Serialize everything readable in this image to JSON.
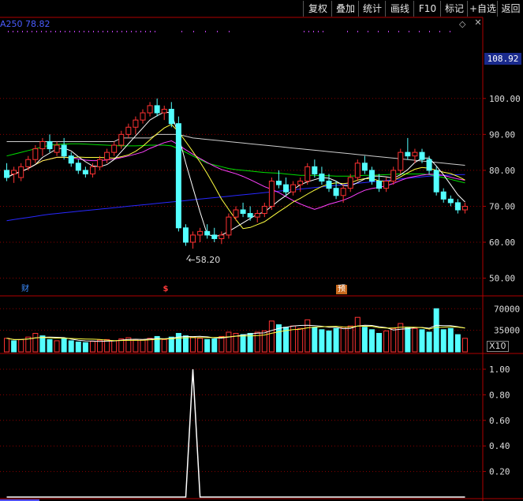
{
  "toolbar": {
    "buttons": [
      "复权",
      "叠加",
      "统计",
      "画线",
      "F10",
      "标记",
      "+自选",
      "返回"
    ]
  },
  "indicator": {
    "ma250_label": "A250",
    "ma250_value": "78.82"
  },
  "price_axis": {
    "ticks": [
      "100.00",
      "90.00",
      "80.00",
      "70.00",
      "60.00",
      "50.00"
    ],
    "current": "108.92"
  },
  "min_marker": {
    "label": "58.20"
  },
  "events": {
    "cai": "财",
    "s": "$",
    "yu": "预"
  },
  "volume_axis": {
    "ticks": [
      "70000",
      "35000"
    ],
    "multiplier": "X10"
  },
  "osc_axis": {
    "ticks": [
      "1.00",
      "0.80",
      "0.60",
      "0.40",
      "0.20"
    ]
  },
  "colors": {
    "up": "#ff3232",
    "down": "#54ffff",
    "ma5": "#ffffff",
    "ma10": "#ffff40",
    "ma20": "#ff40ff",
    "ma60": "#00e000",
    "ma120": "#cccccc",
    "ma250": "#2828ff",
    "grid": "#8b0000"
  },
  "chart_data": {
    "type": "candlestick",
    "ylim": [
      45,
      110
    ],
    "candles": [
      [
        80,
        82,
        77,
        78
      ],
      [
        79,
        81,
        76.5,
        80
      ],
      [
        78,
        82,
        77,
        81
      ],
      [
        81,
        84,
        80,
        83
      ],
      [
        83,
        87,
        82,
        86
      ],
      [
        86,
        89,
        84,
        88
      ],
      [
        88,
        90,
        85,
        86
      ],
      [
        85,
        88,
        84,
        87
      ],
      [
        87,
        89,
        83,
        84
      ],
      [
        84,
        85,
        81,
        82
      ],
      [
        82,
        83,
        79,
        80
      ],
      [
        80,
        81,
        78,
        79
      ],
      [
        79,
        82,
        78,
        81
      ],
      [
        81,
        84,
        80,
        83
      ],
      [
        83,
        86,
        82,
        85
      ],
      [
        85,
        88,
        84,
        87
      ],
      [
        87,
        91,
        86,
        90
      ],
      [
        90,
        93,
        89,
        92
      ],
      [
        92,
        95,
        90,
        94
      ],
      [
        94,
        97,
        93,
        96
      ],
      [
        96,
        99,
        95,
        98
      ],
      [
        98,
        100,
        95,
        96
      ],
      [
        96,
        98,
        94,
        97
      ],
      [
        97,
        99,
        92,
        93
      ],
      [
        93,
        95,
        63,
        64
      ],
      [
        64,
        65,
        59,
        60
      ],
      [
        60,
        63,
        58.2,
        62
      ],
      [
        62,
        64,
        60,
        63
      ],
      [
        63,
        65,
        61,
        62
      ],
      [
        62,
        64,
        60,
        61
      ],
      [
        61,
        63,
        59.5,
        62
      ],
      [
        62,
        68,
        61,
        67
      ],
      [
        67,
        70,
        66,
        69
      ],
      [
        69,
        71,
        67,
        68
      ],
      [
        68,
        70,
        66,
        67
      ],
      [
        67,
        69,
        65.5,
        68
      ],
      [
        68,
        71,
        67,
        70
      ],
      [
        70,
        78,
        69,
        77
      ],
      [
        77,
        80,
        75,
        76
      ],
      [
        76,
        78,
        73,
        74
      ],
      [
        74,
        77,
        73,
        76
      ],
      [
        76,
        78,
        74,
        77
      ],
      [
        77,
        82,
        76,
        81
      ],
      [
        81,
        83,
        78,
        79
      ],
      [
        79,
        81,
        76,
        77
      ],
      [
        77,
        79,
        74,
        75
      ],
      [
        75,
        77,
        72,
        73
      ],
      [
        73,
        76,
        71,
        75
      ],
      [
        75,
        79,
        74,
        78
      ],
      [
        78,
        83,
        77,
        82
      ],
      [
        82,
        84,
        79,
        80
      ],
      [
        80,
        81,
        76,
        77
      ],
      [
        77,
        79,
        74,
        75
      ],
      [
        75,
        78,
        74,
        77
      ],
      [
        77,
        81,
        76,
        80
      ],
      [
        80,
        86,
        79,
        85
      ],
      [
        85,
        89,
        83,
        84
      ],
      [
        84,
        86,
        82,
        85
      ],
      [
        85,
        86,
        82,
        83
      ],
      [
        83,
        84,
        79,
        80
      ],
      [
        80,
        81,
        73,
        74
      ],
      [
        74,
        75,
        71,
        72
      ],
      [
        72,
        73,
        70,
        71
      ],
      [
        71,
        72,
        68,
        69
      ],
      [
        69,
        71,
        68,
        70
      ]
    ],
    "volume": [
      [
        22000,
        "up"
      ],
      [
        18000,
        "down"
      ],
      [
        20000,
        "up"
      ],
      [
        24000,
        "up"
      ],
      [
        30000,
        "up"
      ],
      [
        26000,
        "down"
      ],
      [
        20000,
        "down"
      ],
      [
        18000,
        "up"
      ],
      [
        22000,
        "down"
      ],
      [
        18000,
        "down"
      ],
      [
        16000,
        "down"
      ],
      [
        15000,
        "down"
      ],
      [
        17000,
        "up"
      ],
      [
        19000,
        "up"
      ],
      [
        20000,
        "up"
      ],
      [
        18000,
        "up"
      ],
      [
        21000,
        "up"
      ],
      [
        23000,
        "up"
      ],
      [
        20000,
        "up"
      ],
      [
        19000,
        "up"
      ],
      [
        22000,
        "up"
      ],
      [
        25000,
        "down"
      ],
      [
        20000,
        "up"
      ],
      [
        24000,
        "down"
      ],
      [
        30000,
        "down"
      ],
      [
        26000,
        "down"
      ],
      [
        24000,
        "up"
      ],
      [
        22000,
        "up"
      ],
      [
        20000,
        "down"
      ],
      [
        21000,
        "down"
      ],
      [
        25000,
        "up"
      ],
      [
        32000,
        "up"
      ],
      [
        30000,
        "up"
      ],
      [
        28000,
        "down"
      ],
      [
        30000,
        "down"
      ],
      [
        32000,
        "up"
      ],
      [
        34000,
        "up"
      ],
      [
        50000,
        "up"
      ],
      [
        44000,
        "down"
      ],
      [
        40000,
        "down"
      ],
      [
        42000,
        "up"
      ],
      [
        38000,
        "up"
      ],
      [
        52000,
        "up"
      ],
      [
        40000,
        "down"
      ],
      [
        36000,
        "down"
      ],
      [
        34000,
        "down"
      ],
      [
        38000,
        "down"
      ],
      [
        40000,
        "up"
      ],
      [
        42000,
        "up"
      ],
      [
        56000,
        "up"
      ],
      [
        40000,
        "down"
      ],
      [
        36000,
        "down"
      ],
      [
        30000,
        "down"
      ],
      [
        34000,
        "up"
      ],
      [
        38000,
        "up"
      ],
      [
        46000,
        "up"
      ],
      [
        40000,
        "down"
      ],
      [
        38000,
        "up"
      ],
      [
        36000,
        "down"
      ],
      [
        32000,
        "down"
      ],
      [
        70000,
        "down"
      ],
      [
        36000,
        "down"
      ],
      [
        38000,
        "down"
      ],
      [
        28000,
        "down"
      ],
      [
        22000,
        "up"
      ]
    ],
    "osc": {
      "peak_index": 26,
      "peak_value": 1.0
    },
    "ma120": [
      88,
      88,
      88,
      88,
      88,
      88,
      88,
      88,
      88,
      88,
      88,
      88,
      88,
      88,
      88,
      88,
      89,
      89,
      89,
      89,
      89,
      90,
      90,
      90,
      90,
      89.5,
      89,
      88.8,
      88.6,
      88.4,
      88.2,
      88,
      87.8,
      87.6,
      87.4,
      87.2,
      87,
      86.8,
      86.6,
      86.4,
      86.2,
      86,
      85.8,
      85.6,
      85.4,
      85.2,
      85,
      84.8,
      84.6,
      84.4,
      84.2,
      84,
      83.8,
      83.6,
      83.4,
      83.2,
      83,
      82.8,
      82.6,
      82.4,
      82.2,
      82,
      81.8,
      81.6,
      81.4
    ],
    "ma60": [
      84,
      84.5,
      85,
      85.5,
      86,
      86.5,
      87,
      87.2,
      87.3,
      87.4,
      87.4,
      87.3,
      87.2,
      87.1,
      87,
      86.9,
      86.8,
      86.8,
      86.8,
      86.9,
      87,
      87,
      87,
      86.8,
      86,
      85,
      84,
      83,
      82,
      81.5,
      81,
      80.5,
      80.2,
      80,
      79.8,
      79.6,
      79.4,
      79.3,
      79.2,
      79,
      78.8,
      78.6,
      78.6,
      78.6,
      78.5,
      78.5,
      78.4,
      78.4,
      78.4,
      78.5,
      78.6,
      78.6,
      78.7,
      78.8,
      78.9,
      79,
      79,
      79,
      79,
      78.8,
      78.4,
      78,
      77.5,
      77,
      76.5
    ],
    "ma250": [
      66,
      66.3,
      66.6,
      66.9,
      67.2,
      67.5,
      67.8,
      68,
      68.2,
      68.4,
      68.6,
      68.8,
      69,
      69.2,
      69.4,
      69.6,
      69.8,
      70,
      70.2,
      70.4,
      70.6,
      70.8,
      71,
      71.2,
      71.4,
      71.6,
      71.8,
      72,
      72.2,
      72.4,
      72.6,
      72.8,
      73,
      73.2,
      73.4,
      73.6,
      73.8,
      74,
      74.2,
      74.4,
      74.6,
      74.8,
      75,
      75.2,
      75.4,
      75.6,
      75.8,
      76,
      76.2,
      76.4,
      76.6,
      76.8,
      77,
      77.2,
      77.4,
      77.6,
      77.8,
      78,
      78.2,
      78.4,
      78.5,
      78.6,
      78.7,
      78.8,
      78.82
    ]
  }
}
